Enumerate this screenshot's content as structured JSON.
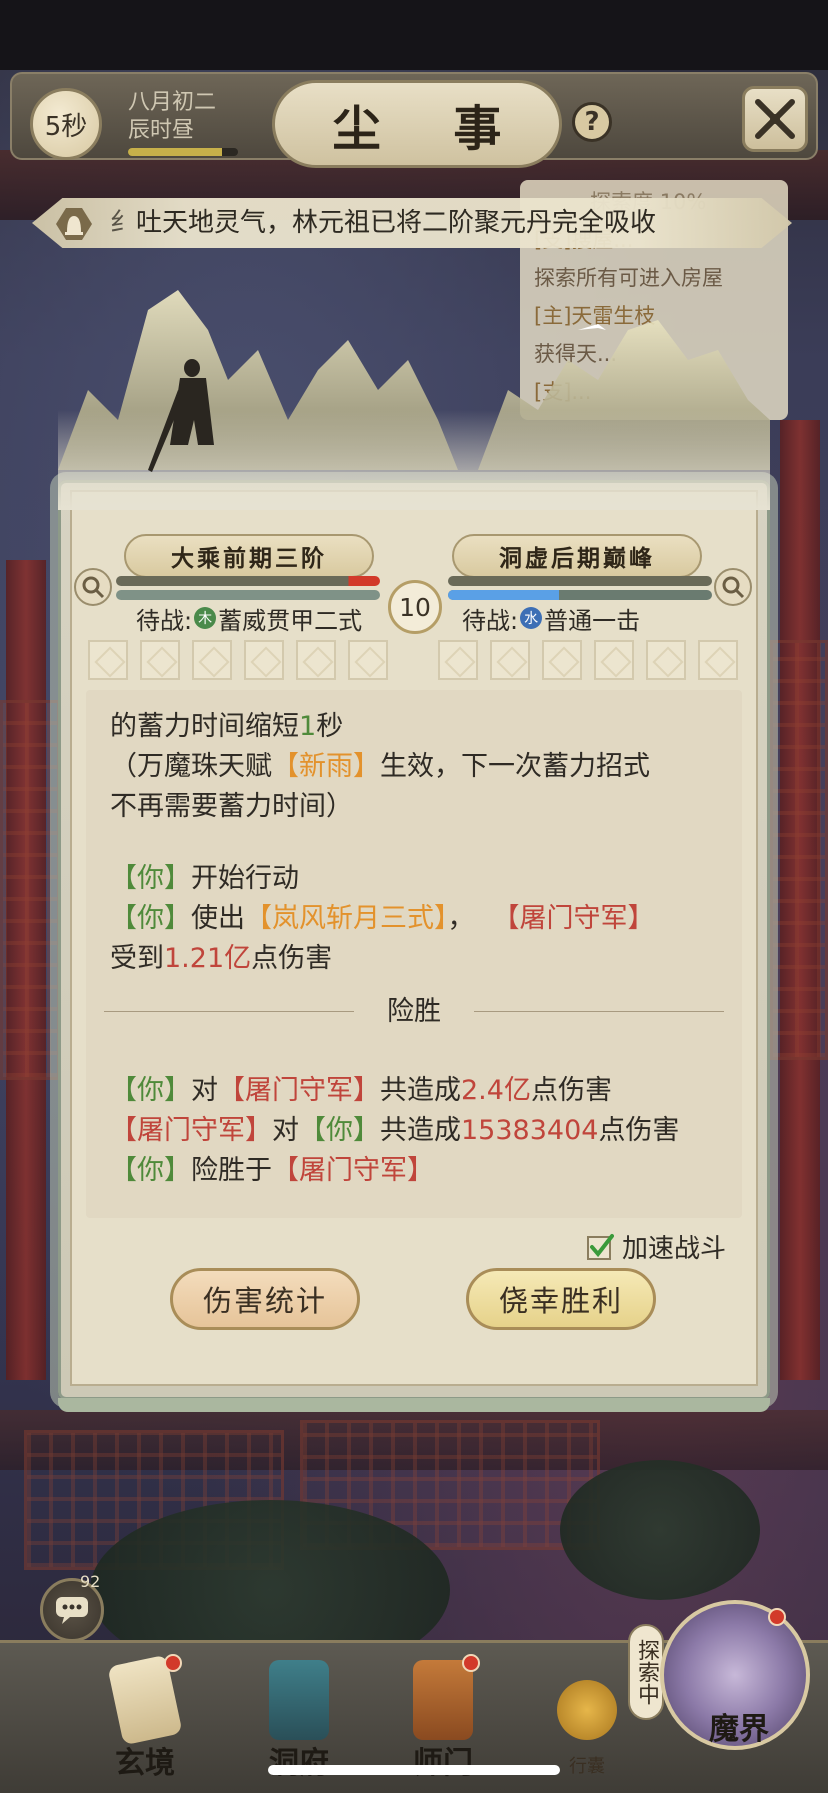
{
  "header": {
    "timer": "5秒",
    "date_line1": "八月初二",
    "date_line2": "辰时昼",
    "day_progress": 0.85,
    "title": "尘 事",
    "help_label": "?"
  },
  "notice": {
    "text": "吐天地灵气，林元祖已将二阶聚元丹完全吸收",
    "clipped_prefix": "纟"
  },
  "quest_panel": {
    "progress_label": "探索度",
    "progress_value": "10%",
    "items": [
      {
        "text": "[支]搜屋...",
        "style": "head"
      },
      {
        "text": "探索所有可进入房屋",
        "style": "body"
      },
      {
        "text": "[主]天雷生枝",
        "style": "head"
      },
      {
        "text": "获得天...",
        "style": "body"
      },
      {
        "text": "[支]...",
        "style": "head"
      }
    ]
  },
  "battle": {
    "left": {
      "realm": "大乘前期三阶",
      "hp": 0.88,
      "secondary": 1.0,
      "pending_prefix": "待战:",
      "element": "木",
      "skill": "蓄威贯甲二式",
      "element_color": "#4a8a4a"
    },
    "right": {
      "realm": "洞虚后期巅峰",
      "hp": 1.0,
      "secondary": 0.42,
      "pending_prefix": "待战:",
      "element": "水",
      "skill": "普通一击",
      "element_color": "#3d6fb5"
    },
    "round": "10",
    "slot_count": 6
  },
  "log": {
    "l1": {
      "a": "的蓄力时间缩短",
      "b": "1",
      "c": "秒"
    },
    "l2": {
      "a": "（万魔珠天赋",
      "b": "【新雨】",
      "c": "生效，下一次蓄力招式"
    },
    "l3": {
      "a": "不再需要蓄力时间）"
    },
    "l4": {
      "a": "【你】",
      "b": "开始行动"
    },
    "l5": {
      "a": "【你】",
      "b": "使出",
      "c": "【岚风斩月三式】",
      "d": "，",
      "e": "【屠门守军】"
    },
    "l6": {
      "a": "受到",
      "b": "1.21亿",
      "c": "点伤害"
    },
    "result": "险胜",
    "s1": {
      "a": "【你】",
      "b": "对",
      "c": "【屠门守军】",
      "d": "共造成",
      "e": "2.4亿",
      "f": "点伤害"
    },
    "s2": {
      "a": "【屠门守军】",
      "b": "对",
      "c": "【你】",
      "d": "共造成",
      "e": "15383404",
      "f": "点伤害"
    },
    "s3": {
      "a": "【你】",
      "b": "险胜于",
      "c": "【屠门守军】"
    }
  },
  "controls": {
    "speed_label": "加速战斗",
    "speed_checked": true,
    "stats_button": "伤害统计",
    "win_button": "侥幸胜利"
  },
  "chat": {
    "count": "92"
  },
  "nav": {
    "items": [
      {
        "label": "玄境",
        "badge": true
      },
      {
        "label": "洞府",
        "badge": false
      },
      {
        "label": "师门",
        "badge": true
      },
      {
        "label": "行囊",
        "badge": false
      },
      {
        "label": "魔界",
        "badge": true
      }
    ],
    "explore_tag": "探索中"
  },
  "colors": {
    "green": "#4f8a3a",
    "orange": "#e3922c",
    "red": "#c0453b",
    "hp_red": "#d23a2a",
    "hp_blue": "#5aa0e6"
  }
}
